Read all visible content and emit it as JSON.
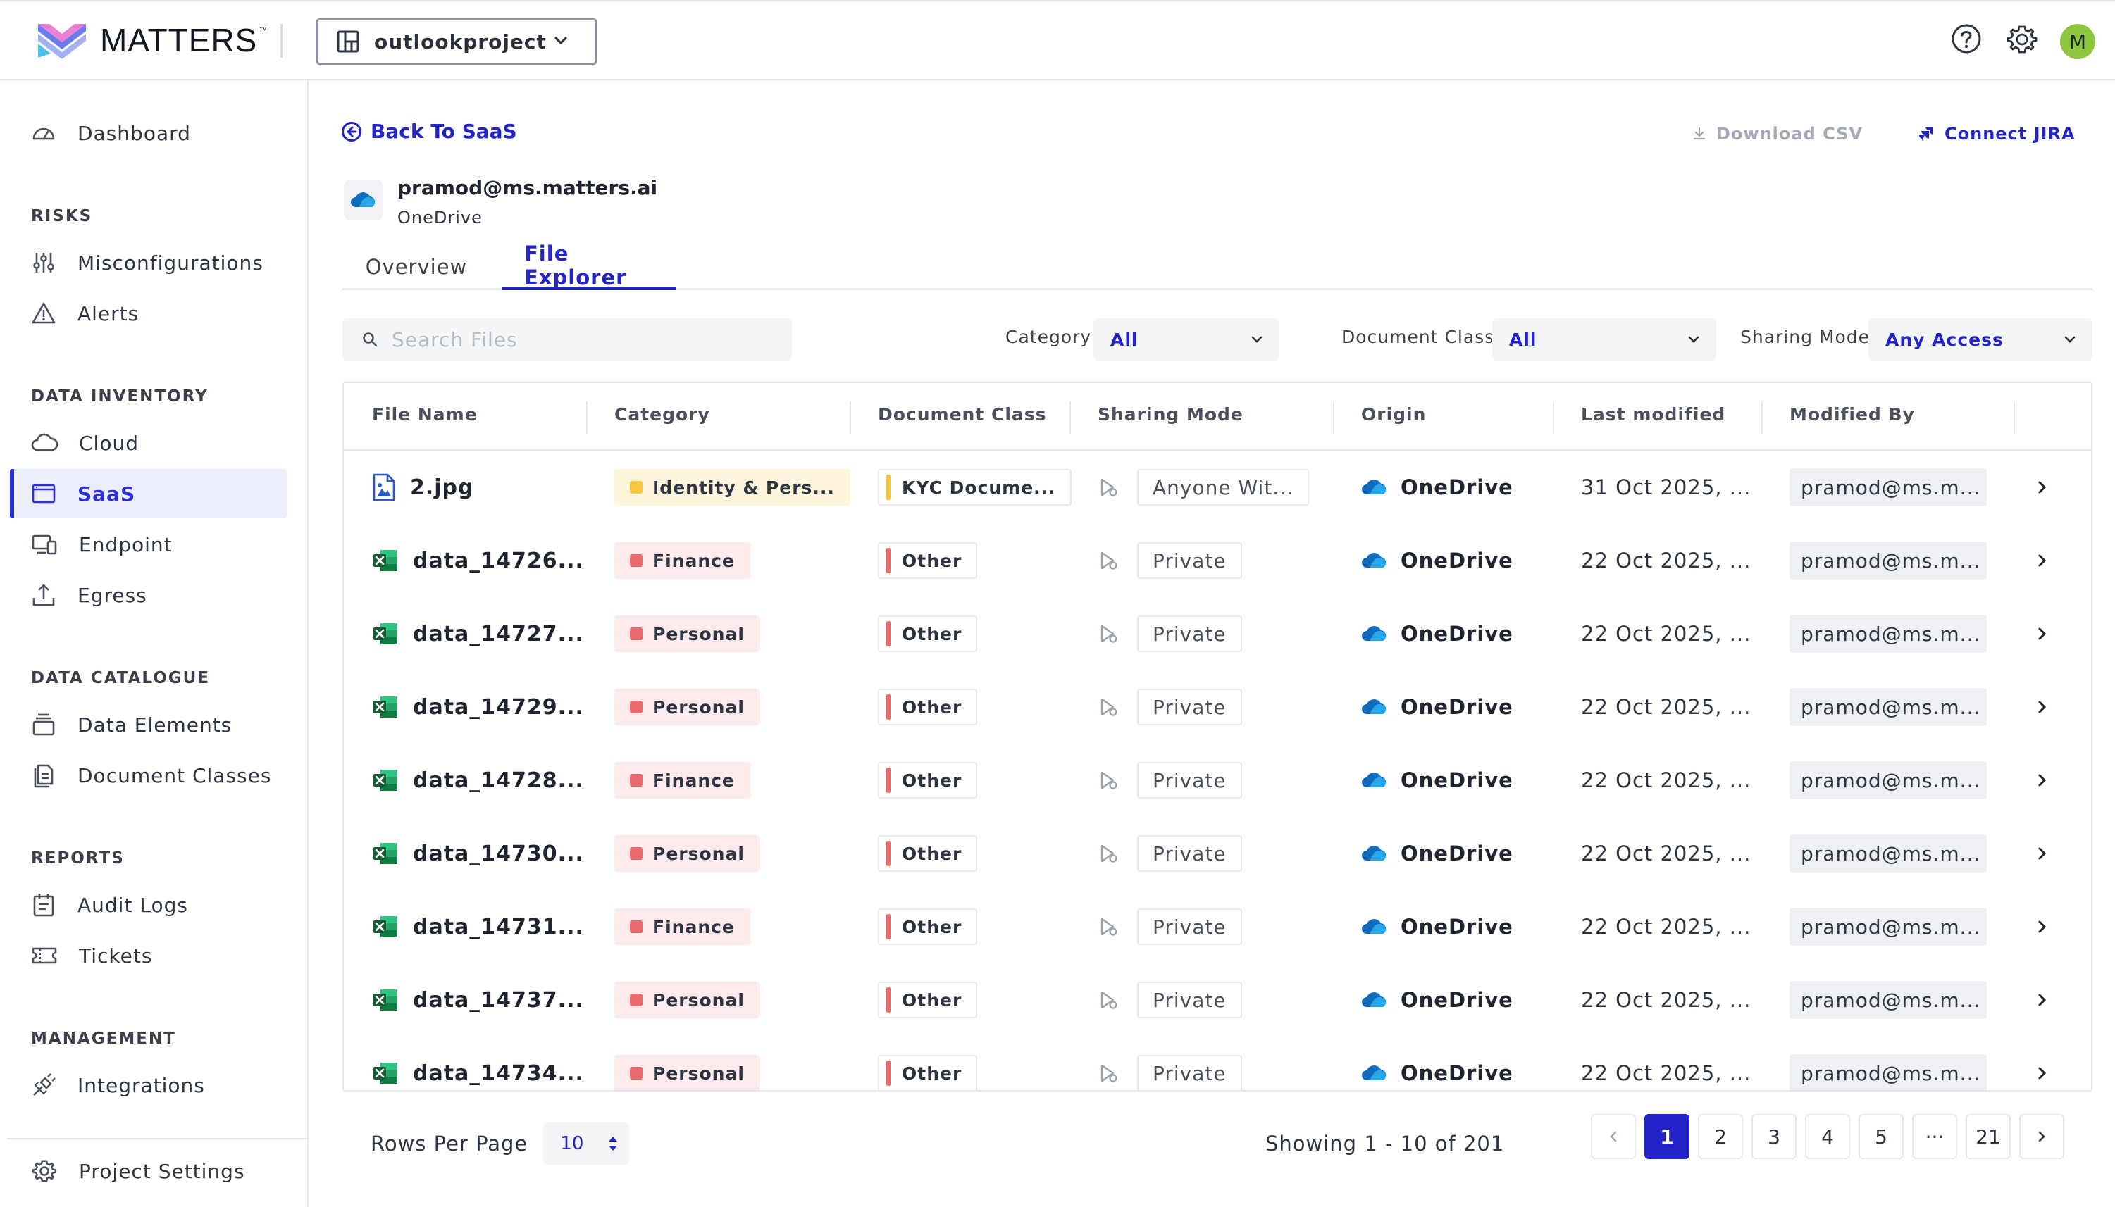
{
  "brand": {
    "name": "MATTERS",
    "tm": "™"
  },
  "project": {
    "name": "outlookproject"
  },
  "topbar": {
    "avatar_initial": "M",
    "help_icon": "question-circle",
    "settings_icon": "gear"
  },
  "sidebar": {
    "dashboard": "Dashboard",
    "sections": {
      "risks": "RISKS",
      "data_inventory": "DATA INVENTORY",
      "data_catalogue": "DATA CATALOGUE",
      "reports": "REPORTS",
      "management": "MANAGEMENT"
    },
    "items": {
      "misconfigurations": "Misconfigurations",
      "alerts": "Alerts",
      "cloud": "Cloud",
      "saas": "SaaS",
      "endpoint": "Endpoint",
      "egress": "Egress",
      "data_elements": "Data Elements",
      "document_classes": "Document Classes",
      "audit_logs": "Audit Logs",
      "tickets": "Tickets",
      "integrations": "Integrations"
    },
    "project_settings": "Project Settings",
    "active": "saas"
  },
  "header": {
    "back_label": "Back To SaaS",
    "download_csv": "Download CSV",
    "connect_jira": "Connect JIRA",
    "account_email": "pramod@ms.matters.ai",
    "account_service": "OneDrive"
  },
  "tabs": [
    {
      "label": "Overview",
      "active": false
    },
    {
      "label": "File Explorer",
      "active": true
    }
  ],
  "filters": {
    "search_placeholder": "Search Files",
    "category_label": "Category",
    "category_value": "All",
    "doc_class_label": "Document Class",
    "doc_class_value": "All",
    "sharing_label": "Sharing Mode",
    "sharing_value": "Any Access"
  },
  "table": {
    "columns": [
      "File Name",
      "Category",
      "Document Class",
      "Sharing Mode",
      "Origin",
      "Last modified",
      "Modified By"
    ],
    "rows": [
      {
        "file": "2.jpg",
        "file_type": "image",
        "category": "Identity & Pers...",
        "category_color": "#f5c842",
        "category_bg": "#fdf6dc",
        "doc_class": "KYC Docume...",
        "doc_color": "#f5c842",
        "sharing": "Anyone Wit...",
        "origin": "OneDrive",
        "modified": "31 Oct 2025, ...",
        "modified_by": "pramod@ms.m..."
      },
      {
        "file": "data_14726...",
        "file_type": "excel",
        "category": "Finance",
        "category_color": "#e86a6a",
        "category_bg": "#fdeaea",
        "doc_class": "Other",
        "doc_color": "#e86a6a",
        "sharing": "Private",
        "origin": "OneDrive",
        "modified": "22 Oct 2025, ...",
        "modified_by": "pramod@ms.m..."
      },
      {
        "file": "data_14727...",
        "file_type": "excel",
        "category": "Personal",
        "category_color": "#e86a6a",
        "category_bg": "#fdeaea",
        "doc_class": "Other",
        "doc_color": "#e86a6a",
        "sharing": "Private",
        "origin": "OneDrive",
        "modified": "22 Oct 2025, ...",
        "modified_by": "pramod@ms.m..."
      },
      {
        "file": "data_14729...",
        "file_type": "excel",
        "category": "Personal",
        "category_color": "#e86a6a",
        "category_bg": "#fdeaea",
        "doc_class": "Other",
        "doc_color": "#e86a6a",
        "sharing": "Private",
        "origin": "OneDrive",
        "modified": "22 Oct 2025, ...",
        "modified_by": "pramod@ms.m..."
      },
      {
        "file": "data_14728...",
        "file_type": "excel",
        "category": "Finance",
        "category_color": "#e86a6a",
        "category_bg": "#fdeaea",
        "doc_class": "Other",
        "doc_color": "#e86a6a",
        "sharing": "Private",
        "origin": "OneDrive",
        "modified": "22 Oct 2025, ...",
        "modified_by": "pramod@ms.m..."
      },
      {
        "file": "data_14730...",
        "file_type": "excel",
        "category": "Personal",
        "category_color": "#e86a6a",
        "category_bg": "#fdeaea",
        "doc_class": "Other",
        "doc_color": "#e86a6a",
        "sharing": "Private",
        "origin": "OneDrive",
        "modified": "22 Oct 2025, ...",
        "modified_by": "pramod@ms.m..."
      },
      {
        "file": "data_14731...",
        "file_type": "excel",
        "category": "Finance",
        "category_color": "#e86a6a",
        "category_bg": "#fdeaea",
        "doc_class": "Other",
        "doc_color": "#e86a6a",
        "sharing": "Private",
        "origin": "OneDrive",
        "modified": "22 Oct 2025, ...",
        "modified_by": "pramod@ms.m..."
      },
      {
        "file": "data_14737...",
        "file_type": "excel",
        "category": "Personal",
        "category_color": "#e86a6a",
        "category_bg": "#fdeaea",
        "doc_class": "Other",
        "doc_color": "#e86a6a",
        "sharing": "Private",
        "origin": "OneDrive",
        "modified": "22 Oct 2025, ...",
        "modified_by": "pramod@ms.m..."
      },
      {
        "file": "data_14734...",
        "file_type": "excel",
        "category": "Personal",
        "category_color": "#e86a6a",
        "category_bg": "#fdeaea",
        "doc_class": "Other",
        "doc_color": "#e86a6a",
        "sharing": "Private",
        "origin": "OneDrive",
        "modified": "22 Oct 2025, ...",
        "modified_by": "pramod@ms.m..."
      }
    ]
  },
  "pagination": {
    "rows_per_page_label": "Rows Per Page",
    "rows_per_page": "10",
    "showing": "Showing 1 - 10 of 201",
    "pages": [
      "1",
      "2",
      "3",
      "4",
      "5",
      "···",
      "21"
    ],
    "current": "1"
  },
  "colors": {
    "accent": "#2224c9",
    "active_bg": "#eceffa",
    "onedrive": "#0f6cbd",
    "excel": "#1d7044",
    "avatar": "#8dc63f"
  }
}
